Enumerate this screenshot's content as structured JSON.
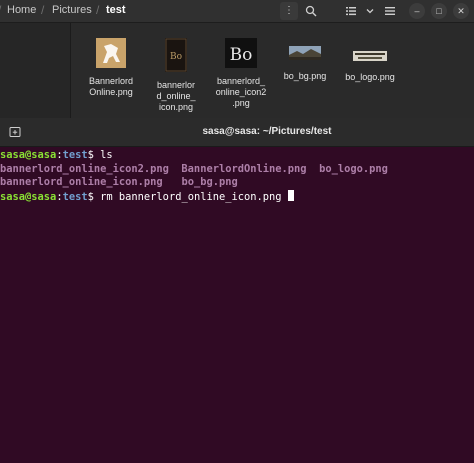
{
  "file_manager": {
    "breadcrumbs": [
      "Home",
      "Pictures",
      "test"
    ],
    "files": [
      {
        "name_lines": [
          "Bannerlord",
          "Online.png"
        ],
        "icon": "horse-thumbnail-icon"
      },
      {
        "name_lines": [
          "bannerlor",
          "d_online_",
          "icon.png"
        ],
        "icon": "bo-dark-thumbnail-icon"
      },
      {
        "name_lines": [
          "bannerlord_",
          "online_icon2",
          ".png"
        ],
        "icon": "bo-letters-thumbnail-icon"
      },
      {
        "name_lines": [
          "bo_bg.png"
        ],
        "icon": "landscape-thumbnail-icon"
      },
      {
        "name_lines": [
          "bo_logo.png"
        ],
        "icon": "logo-thumbnail-icon"
      }
    ]
  },
  "terminal": {
    "title": "sasa@sasa: ~/Pictures/test",
    "lines": [
      {
        "user": "sasa@sasa",
        "sep": ":",
        "path": "test",
        "prompt": "$ ",
        "cmd": "ls"
      },
      {
        "files": [
          "bannerlord_online_icon2.png",
          "BannerlordOnline.png",
          "bo_logo.png"
        ]
      },
      {
        "files": [
          "bannerlord_online_icon.png",
          "bo_bg.png"
        ]
      },
      {
        "user": "sasa@sasa",
        "sep": ":",
        "path": "test",
        "prompt": "$ ",
        "cmd": "rm bannerlord_online_icon.png "
      }
    ]
  },
  "colors": {
    "terminal_bg": "#300a24",
    "user_green": "#8ae234",
    "path_blue": "#729fcf",
    "image_file_purple": "#ad7fa8"
  }
}
